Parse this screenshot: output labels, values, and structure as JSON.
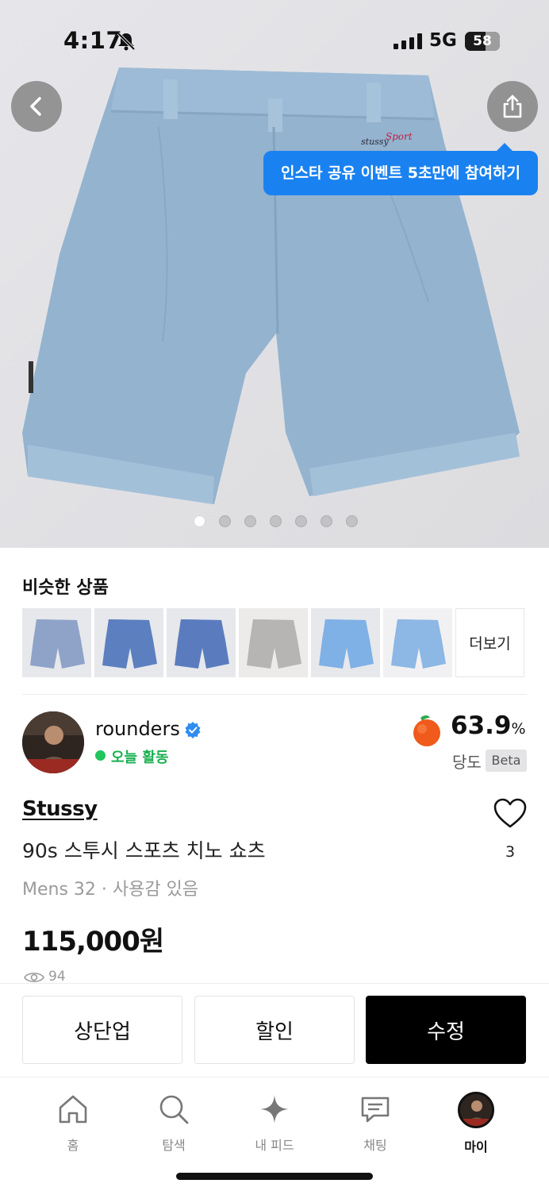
{
  "status_bar": {
    "time": "4:17",
    "network": "5G",
    "battery": "58",
    "battery_level": 0.58
  },
  "hero": {
    "tooltip": "인스타 공유 이벤트 5초만에 참여하기",
    "image_count": 7,
    "active_index": 0
  },
  "similar": {
    "title": "비슷한 상품",
    "more_label": "더보기",
    "thumb_colors": [
      "#8fa3c9",
      "#5c7fc0",
      "#5a7cbf",
      "#b7b5b3",
      "#7fb0e6",
      "#8db7e4"
    ]
  },
  "seller": {
    "name": "rounders",
    "status": "오늘 활동",
    "score": "63.9",
    "score_unit": "%",
    "score_label": "당도",
    "beta": "Beta"
  },
  "product": {
    "brand": "Stussy",
    "title": "90s 스투시 스포츠 치노 쇼츠",
    "meta": "Mens 32 · 사용감 있음",
    "price": "115,000원",
    "likes": "3",
    "views": "94"
  },
  "actions": {
    "bump": "상단업",
    "discount": "할인",
    "edit": "수정"
  },
  "tabs": [
    {
      "label": "홈",
      "icon": "home-icon"
    },
    {
      "label": "탐색",
      "icon": "search-icon"
    },
    {
      "label": "내 피드",
      "icon": "sparkle-icon"
    },
    {
      "label": "채팅",
      "icon": "chat-icon"
    },
    {
      "label": "마이",
      "icon": "avatar"
    }
  ],
  "colors": {
    "accent": "#1a82f0",
    "active_green": "#21c45d",
    "primary_button": "#000000"
  }
}
